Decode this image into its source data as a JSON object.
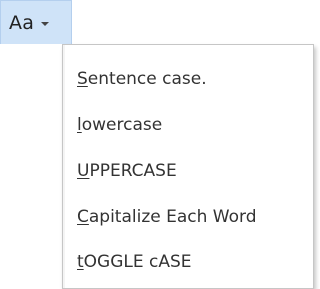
{
  "case_button": {
    "label": "Aa",
    "icon": "chevron-down-icon"
  },
  "menu": {
    "items": [
      {
        "mnemonic": "S",
        "rest": "entence case."
      },
      {
        "mnemonic": "l",
        "rest": "owercase"
      },
      {
        "mnemonic": "U",
        "rest": "PPERCASE"
      },
      {
        "mnemonic": "C",
        "rest": "apitalize Each Word"
      },
      {
        "mnemonic": "t",
        "rest": "OGGLE cASE"
      }
    ]
  },
  "colors": {
    "button_bg": "#cfe3f8",
    "menu_border": "#c6c6c6",
    "text": "#333333"
  }
}
